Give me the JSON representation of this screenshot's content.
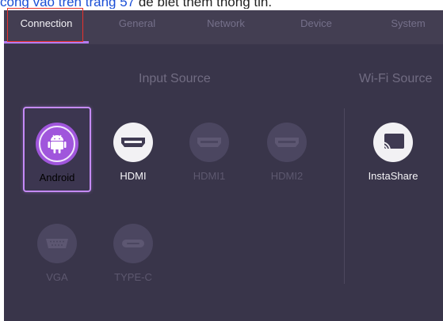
{
  "caption": {
    "link_text": "công vào trên trang 57",
    "rest_text": " để biết thêm thông tin."
  },
  "tabs": [
    {
      "label": "Connection",
      "active": true
    },
    {
      "label": "General",
      "active": false
    },
    {
      "label": "Network",
      "active": false
    },
    {
      "label": "Device",
      "active": false
    },
    {
      "label": "System",
      "active": false
    }
  ],
  "sections": {
    "input_source": "Input Source",
    "wifi_source": "Wi-Fi Source"
  },
  "sources": [
    {
      "label": "Android",
      "icon": "android-icon",
      "state": "selected"
    },
    {
      "label": "HDMI",
      "icon": "hdmi-port-icon",
      "state": "available"
    },
    {
      "label": "HDMI1",
      "icon": "hdmi-port-icon",
      "state": "disabled"
    },
    {
      "label": "HDMI2",
      "icon": "hdmi-port-icon",
      "state": "disabled"
    },
    {
      "label": "VGA",
      "icon": "vga-port-icon",
      "state": "disabled"
    },
    {
      "label": "TYPE-C",
      "icon": "usb-c-port-icon",
      "state": "disabled"
    },
    {
      "label": "InstaShare",
      "icon": "cast-screen-icon",
      "state": "available"
    }
  ],
  "colors": {
    "background": "#39354a",
    "tab_bar": "#433e52",
    "accent": "#b57bf0",
    "android_circle": "#a056dc",
    "annotation_box": "#e8322c"
  }
}
